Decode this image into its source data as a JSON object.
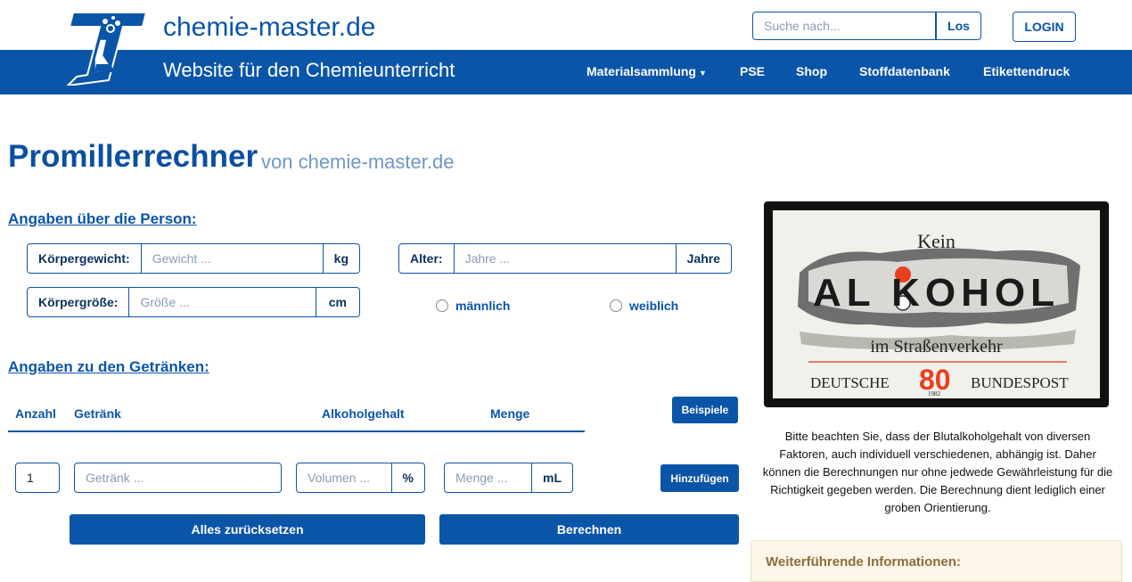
{
  "header": {
    "brand": "chemie-master.de",
    "tagline": "Website für den Chemieunterricht",
    "search_placeholder": "Suche nach...",
    "search_button": "Los",
    "login_button": "LOGIN"
  },
  "nav": {
    "items": [
      "Materialsammlung",
      "PSE",
      "Shop",
      "Stoffdatenbank",
      "Etikettendruck"
    ]
  },
  "page": {
    "title": "Promillerrechner",
    "subtitle": "von chemie-master.de"
  },
  "person": {
    "heading": "Angaben über die Person:",
    "weight_label": "Körpergewicht:",
    "weight_placeholder": "Gewicht ...",
    "weight_unit": "kg",
    "height_label": "Körpergröße:",
    "height_placeholder": "Größe ...",
    "height_unit": "cm",
    "age_label": "Alter:",
    "age_placeholder": "Jahre ...",
    "age_unit": "Jahre",
    "male_label": "männlich",
    "female_label": "weiblich"
  },
  "drinks": {
    "heading": "Angaben zu den Getränken:",
    "col_count": "Anzahl",
    "col_drink": "Getränk",
    "col_alcohol": "Alkoholgehalt",
    "col_amount": "Menge",
    "examples_button": "Beispiele",
    "count_value": "1",
    "drink_placeholder": "Getränk ...",
    "volume_placeholder": "Volumen ...",
    "volume_unit": "%",
    "amount_placeholder": "Menge ...",
    "amount_unit": "mL",
    "add_button": "Hinzufügen",
    "reset_button": "Alles zurücksetzen",
    "calc_button": "Berechnen"
  },
  "stamp": {
    "top": "Kein",
    "main": "AL KOHOL",
    "sub": "im Straßenverkehr",
    "left": "DEUTSCHE",
    "value": "80",
    "right": "BUNDESPOST",
    "year": "1982"
  },
  "disclaimer": "Bitte beachten Sie, dass der Blutalkoholgehalt von diversen Faktoren, auch individuell verschiedenen, abhängig ist. Daher können die Berechnungen nur ohne jedwede Gewährleistung für die Richtigkeit gegeben werden. Die Berechnung dient lediglich einer groben Orientierung.",
  "info": {
    "heading": "Weiterführende Informationen:"
  }
}
